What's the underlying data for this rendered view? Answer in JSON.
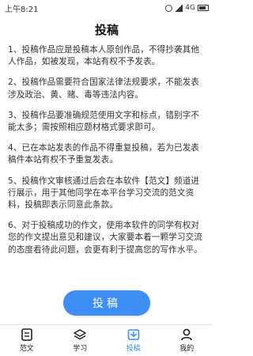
{
  "status_bar": {
    "time": "上午8:21",
    "network": "4G"
  },
  "header": {
    "title": "投稿"
  },
  "content": {
    "paragraphs": [
      "1、投稿作品应是投稿本人原创作品，不得抄袭其他人作品，如被发现，本站有权不予发表。",
      "2、投稿作品需要符合国家法律法规要求，不能发表涉及政治、黄、赌、毒等违法内容。",
      "3、投稿作品要准确规范使用文字和标点，错别字不能太多；需按照相应题材格式要求即可。",
      "4、已在本站发表的作品不得重复投稿，若为已发表稿件本站有权不予重复发表。",
      "5、投稿作文审核通过后会在本软件【范文】频道进行展示，用于其他同学在本平台学习交流的范文资料，投稿即表示同意此条款。",
      "6、对于投稿成功的作文，使用本软件的同学有权对您的作文提出意见和建议，大家要本着一颗学习交流的态度看待此问题，会更有利于提高您的写作水平。"
    ]
  },
  "submit": {
    "label": "投稿"
  },
  "tabs": [
    {
      "label": "范文",
      "icon": "document-icon",
      "active": false
    },
    {
      "label": "学习",
      "icon": "layers-icon",
      "active": false
    },
    {
      "label": "投稿",
      "icon": "submit-icon",
      "active": true
    },
    {
      "label": "我的",
      "icon": "person-icon",
      "active": false
    }
  ],
  "colors": {
    "accent": "#3e8ef7",
    "text": "#333333"
  }
}
